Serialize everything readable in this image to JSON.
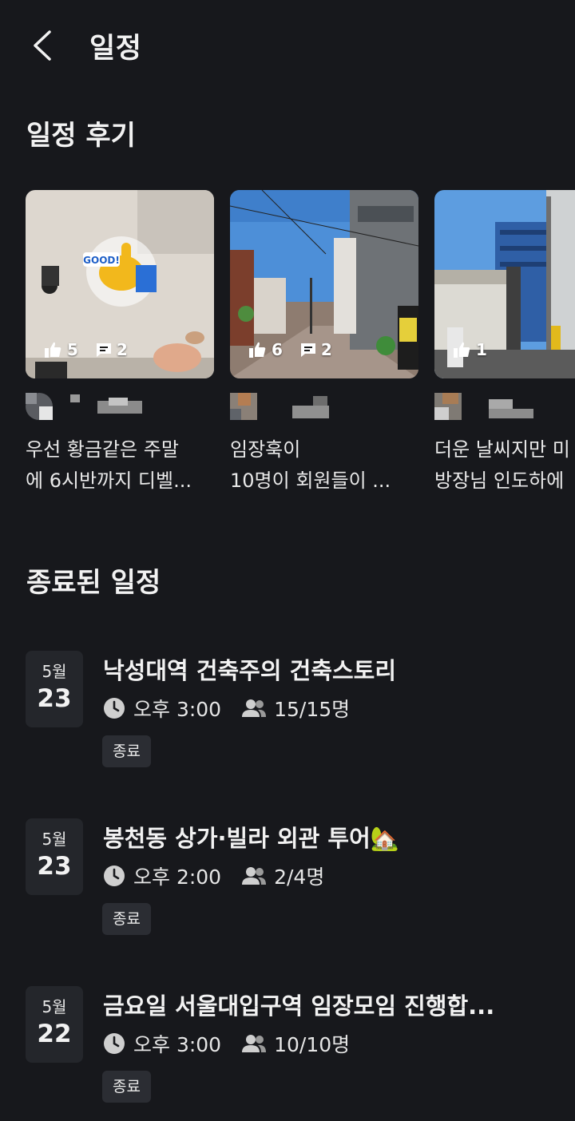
{
  "header": {
    "title": "일정"
  },
  "reviews": {
    "title": "일정 후기",
    "items": [
      {
        "likes": "5",
        "comments": "2",
        "line1": "우선 황금같은 주말",
        "line2": "에 6시반까지 디벨..."
      },
      {
        "likes": "6",
        "comments": "2",
        "line1": "임장훅이",
        "line2": "10명이 회원들이 ..."
      },
      {
        "likes": "1",
        "comments": "",
        "line1": "더운 날씨지만 미",
        "line2": "방장님 인도하에"
      }
    ]
  },
  "ended": {
    "title": "종료된 일정",
    "events": [
      {
        "month": "5월",
        "day": "23",
        "title": "낙성대역 건축주의 건축스토리",
        "time": "오후 3:00",
        "members": "15/15명",
        "status": "종료"
      },
      {
        "month": "5월",
        "day": "23",
        "title": "봉천동 상가·빌라 외관 투어🏡",
        "time": "오후 2:00",
        "members": "2/4명",
        "status": "종료"
      },
      {
        "month": "5월",
        "day": "22",
        "title": "금요일 서울대입구역 임장모임 진행합...",
        "time": "오후 3:00",
        "members": "10/10명",
        "status": "종료"
      }
    ]
  },
  "icons": {
    "back": "back-arrow-icon",
    "like": "thumbs-up-icon",
    "comment": "comment-icon",
    "clock": "clock-icon",
    "people": "people-icon"
  }
}
